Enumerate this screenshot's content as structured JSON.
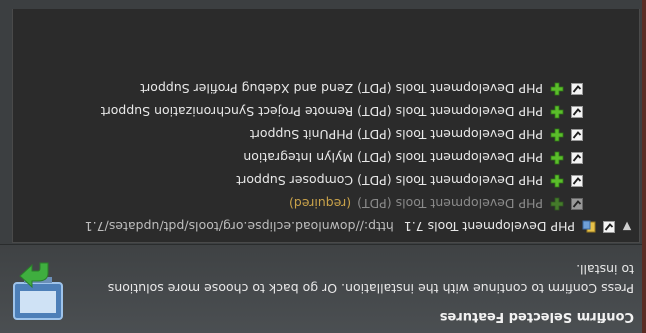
{
  "header": {
    "title": "Confirm Selected Features",
    "description": "Press Confirm to continue with the installation. Or go back to choose more solutions to install.",
    "banner_icon": "install-wizard-icon"
  },
  "tree": {
    "root": {
      "expander_icon": "chevron-down-icon",
      "icon": "plugin-icon",
      "name": "PHP Development Tools 7.1",
      "url": "http://download.eclipse.org/tools/pdt/updates/7.1",
      "checked": true
    },
    "children": [
      {
        "name": "PHP Development Tools (PDT)",
        "note": "(required)",
        "checked": true,
        "enabled": false,
        "icon": "plus-icon"
      },
      {
        "name": "PHP Development Tools (PDT) Composer Support",
        "checked": true,
        "enabled": true,
        "icon": "plus-icon"
      },
      {
        "name": "PHP Development Tools (PDT) Mylyn Integration",
        "checked": true,
        "enabled": true,
        "icon": "plus-icon"
      },
      {
        "name": "PHP Development Tools (PDT) PHPUnit Support",
        "checked": true,
        "enabled": true,
        "icon": "plus-icon"
      },
      {
        "name": "PHP Development Tools (PDT) Remote Project Synchronization Support",
        "checked": true,
        "enabled": true,
        "icon": "plus-icon"
      },
      {
        "name": "PHP Development Tools (PDT) Zend and Xdebug Profiler Support",
        "checked": true,
        "enabled": true,
        "icon": "plus-icon"
      }
    ]
  },
  "colors": {
    "plus_green": "#5bbd2b",
    "required_note": "#c9a24a",
    "tree_bg": "#2b2b2b"
  }
}
